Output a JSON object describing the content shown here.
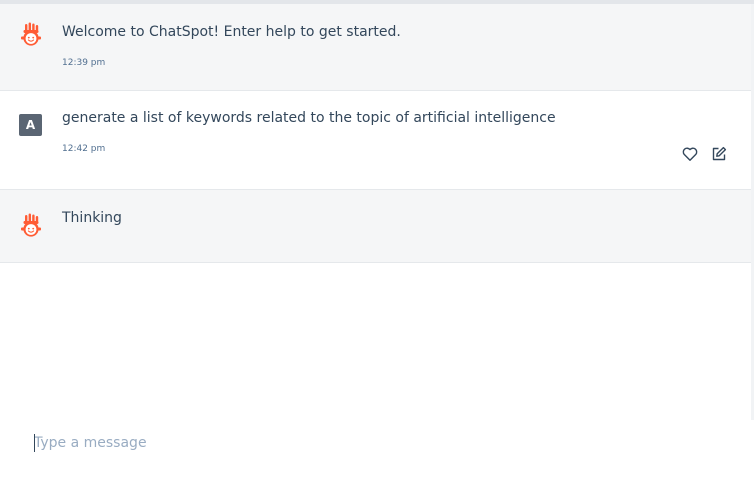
{
  "colors": {
    "brand": "#ff5c35",
    "bot_row_bg": "#f5f6f7",
    "text": "#33475b",
    "muted": "#516f90",
    "placeholder": "#99acc2"
  },
  "messages": [
    {
      "sender": "bot",
      "avatar_icon": "chatspot-bot-icon",
      "text": "Welcome to ChatSpot! Enter help to get started.",
      "time": "12:39 pm"
    },
    {
      "sender": "user",
      "avatar_initial": "A",
      "text": "generate a list of keywords related to the topic of artificial intelligence",
      "time": "12:42 pm",
      "actions": [
        {
          "name": "like",
          "icon": "heart-icon"
        },
        {
          "name": "edit",
          "icon": "edit-icon"
        }
      ]
    },
    {
      "sender": "bot",
      "avatar_icon": "chatspot-bot-icon",
      "text": "Thinking"
    }
  ],
  "composer": {
    "placeholder": "Type a message",
    "value": ""
  }
}
